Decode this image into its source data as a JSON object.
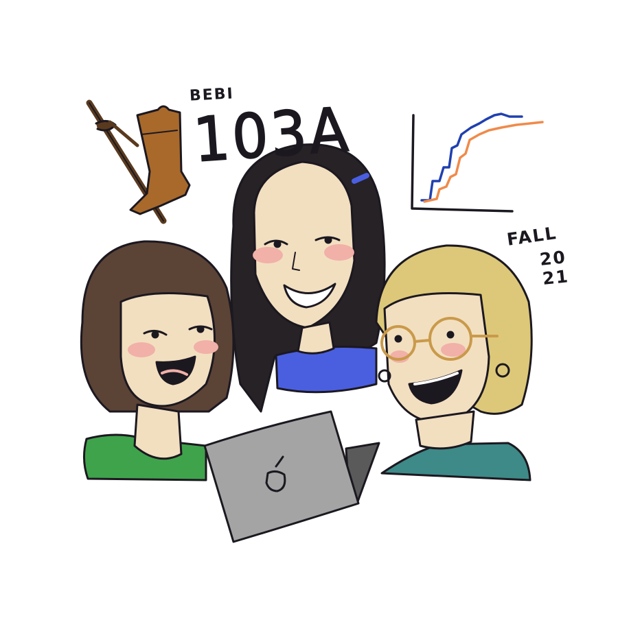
{
  "illustration": {
    "course_code": "BEBI",
    "course_number": "103A",
    "term_label": "FALL",
    "year_line1": "20",
    "year_line2": "21"
  },
  "colors": {
    "ink": "#1c1820",
    "hair_brown": "#5b4336",
    "hair_black": "#262226",
    "hair_blonde": "#dcc878",
    "skin": "#f2dfc0",
    "cheek": "#f1b0a8",
    "shirt_green": "#3fa34c",
    "shirt_blue": "#4a5fe0",
    "shirt_teal": "#3d8a88",
    "boot": "#a8692b",
    "stick": "#5a3a1e",
    "laptop": "#a4a4a4",
    "plot_blue": "#2040b0",
    "plot_orange": "#f08a4a"
  }
}
